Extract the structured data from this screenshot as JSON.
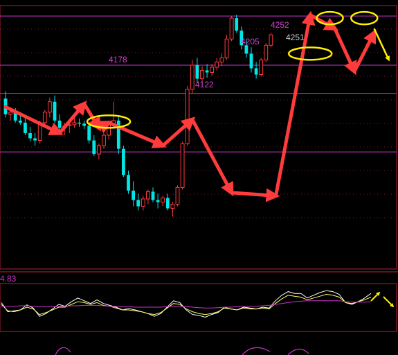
{
  "chart_data": [
    {
      "type": "candlestick",
      "price_labels": [
        {
          "text": "4252",
          "color": "#d040d0"
        },
        {
          "text": "4251",
          "color": "#c8c8c8"
        },
        {
          "text": "4205",
          "color": "#d040d0"
        },
        {
          "text": "4178",
          "color": "#d040d0"
        },
        {
          "text": "4122",
          "color": "#d040d0"
        }
      ],
      "levels": [
        4252,
        4205,
        4178,
        4122
      ],
      "ylim": [
        4010,
        4262
      ],
      "colors": {
        "up": "#ff3c3c",
        "down": "#00e5e5",
        "level": "#cc33cc",
        "arrow": "#ff3b3b",
        "circle": "#ffee00"
      },
      "candles": [
        [
          4173,
          4180,
          4155,
          4158
        ],
        [
          4158,
          4165,
          4152,
          4160
        ],
        [
          4160,
          4164,
          4150,
          4152
        ],
        [
          4152,
          4160,
          4148,
          4150
        ],
        [
          4150,
          4154,
          4138,
          4140
        ],
        [
          4140,
          4146,
          4132,
          4135
        ],
        [
          4135,
          4140,
          4128,
          4133
        ],
        [
          4133,
          4152,
          4130,
          4150
        ],
        [
          4150,
          4162,
          4147,
          4160
        ],
        [
          4160,
          4174,
          4155,
          4170
        ],
        [
          4170,
          4176,
          4150,
          4152
        ],
        [
          4152,
          4158,
          4140,
          4145
        ],
        [
          4145,
          4150,
          4138,
          4147
        ],
        [
          4147,
          4152,
          4140,
          4148
        ],
        [
          4148,
          4155,
          4145,
          4150
        ],
        [
          4150,
          4154,
          4146,
          4149
        ],
        [
          4149,
          4152,
          4144,
          4147
        ],
        [
          4147,
          4150,
          4130,
          4133
        ],
        [
          4133,
          4138,
          4118,
          4120
        ],
        [
          4120,
          4130,
          4115,
          4128
        ],
        [
          4128,
          4140,
          4125,
          4138
        ],
        [
          4138,
          4150,
          4134,
          4148
        ],
        [
          4148,
          4170,
          4145,
          4152
        ],
        [
          4152,
          4156,
          4120,
          4125
        ],
        [
          4125,
          4128,
          4098,
          4100
        ],
        [
          4100,
          4104,
          4082,
          4085
        ],
        [
          4085,
          4094,
          4070,
          4076
        ],
        [
          4076,
          4082,
          4066,
          4070
        ],
        [
          4070,
          4080,
          4066,
          4077
        ],
        [
          4077,
          4086,
          4072,
          4084
        ],
        [
          4084,
          4088,
          4074,
          4076
        ],
        [
          4076,
          4082,
          4068,
          4074
        ],
        [
          4074,
          4080,
          4070,
          4078
        ],
        [
          4078,
          4082,
          4066,
          4068
        ],
        [
          4068,
          4074,
          4060,
          4072
        ],
        [
          4072,
          4090,
          4070,
          4088
        ],
        [
          4088,
          4132,
          4086,
          4130
        ],
        [
          4130,
          4185,
          4128,
          4182
        ],
        [
          4182,
          4210,
          4178,
          4205
        ],
        [
          4205,
          4212,
          4188,
          4192
        ],
        [
          4192,
          4204,
          4186,
          4200
        ],
        [
          4200,
          4206,
          4193,
          4198
        ],
        [
          4198,
          4206,
          4195,
          4203
        ],
        [
          4203,
          4212,
          4200,
          4208
        ],
        [
          4208,
          4216,
          4204,
          4212
        ],
        [
          4212,
          4234,
          4210,
          4230
        ],
        [
          4230,
          4252,
          4228,
          4250
        ],
        [
          4250,
          4253,
          4236,
          4238
        ],
        [
          4238,
          4242,
          4220,
          4224
        ],
        [
          4224,
          4230,
          4212,
          4216
        ],
        [
          4216,
          4222,
          4198,
          4202
        ],
        [
          4202,
          4208,
          4192,
          4196
        ],
        [
          4196,
          4212,
          4194,
          4210
        ],
        [
          4210,
          4226,
          4208,
          4224
        ],
        [
          4224,
          4236,
          4222,
          4234
        ]
      ],
      "zigzag_arrows": [
        [
          0,
          4165,
          11,
          4140
        ],
        [
          11,
          4140,
          16,
          4168
        ],
        [
          16,
          4168,
          19,
          4145
        ],
        [
          19,
          4145,
          21,
          4150
        ],
        [
          21,
          4150,
          32,
          4128
        ],
        [
          32,
          4128,
          38,
          4153
        ],
        [
          38,
          4153,
          46,
          4083
        ],
        [
          46,
          4083,
          55,
          4080
        ],
        [
          55,
          4080,
          62,
          4253
        ],
        [
          62,
          4253,
          67,
          4240
        ],
        [
          67,
          4240,
          71,
          4199
        ],
        [
          71,
          4199,
          75,
          4236
        ]
      ],
      "circles": [
        [
          21,
          4151
        ],
        [
          62,
          4216
        ],
        [
          66,
          4250
        ],
        [
          73,
          4250
        ]
      ],
      "forecast_arrows": [
        [
          75,
          4240,
          78,
          4210
        ]
      ]
    },
    {
      "type": "line",
      "indicator_value": "4.83",
      "ylim": [
        0,
        100
      ],
      "series": [
        {
          "color": "#ffffff",
          "values": [
            60,
            40,
            42,
            44,
            55,
            48,
            30,
            36,
            46,
            56,
            52,
            62,
            70,
            64,
            58,
            66,
            58,
            54,
            50,
            44,
            47,
            44,
            40,
            36,
            30,
            36,
            50,
            64,
            60,
            44,
            34,
            32,
            28,
            34,
            38,
            50,
            46,
            44,
            50,
            48,
            46,
            50,
            48,
            64,
            76,
            84,
            80,
            80,
            70,
            76,
            82,
            86,
            84,
            78,
            60,
            56,
            62,
            70,
            80
          ]
        },
        {
          "color": "#ffff66",
          "values": [
            56,
            42,
            40,
            44,
            50,
            46,
            34,
            38,
            44,
            50,
            50,
            56,
            62,
            60,
            56,
            60,
            54,
            52,
            48,
            44,
            44,
            42,
            40,
            36,
            34,
            38,
            48,
            58,
            56,
            46,
            40,
            36,
            34,
            36,
            40,
            48,
            46,
            44,
            48,
            46,
            46,
            48,
            46,
            58,
            68,
            76,
            74,
            72,
            66,
            70,
            74,
            78,
            76,
            72,
            60,
            58,
            62,
            66,
            72
          ]
        },
        {
          "color": "#cc33cc",
          "values": [
            52,
            52,
            52,
            53,
            53,
            52,
            51,
            51,
            51,
            52,
            52,
            53,
            53,
            54,
            54,
            54,
            53,
            52,
            52,
            51,
            51,
            50,
            50,
            50,
            50,
            50,
            51,
            52,
            52,
            51,
            50,
            49,
            48,
            48,
            49,
            50,
            50,
            51,
            52,
            52,
            52,
            53,
            54,
            56,
            58,
            60,
            62,
            63,
            64,
            64,
            64,
            64,
            64,
            64,
            62,
            61,
            61,
            61,
            62
          ]
        }
      ]
    }
  ]
}
